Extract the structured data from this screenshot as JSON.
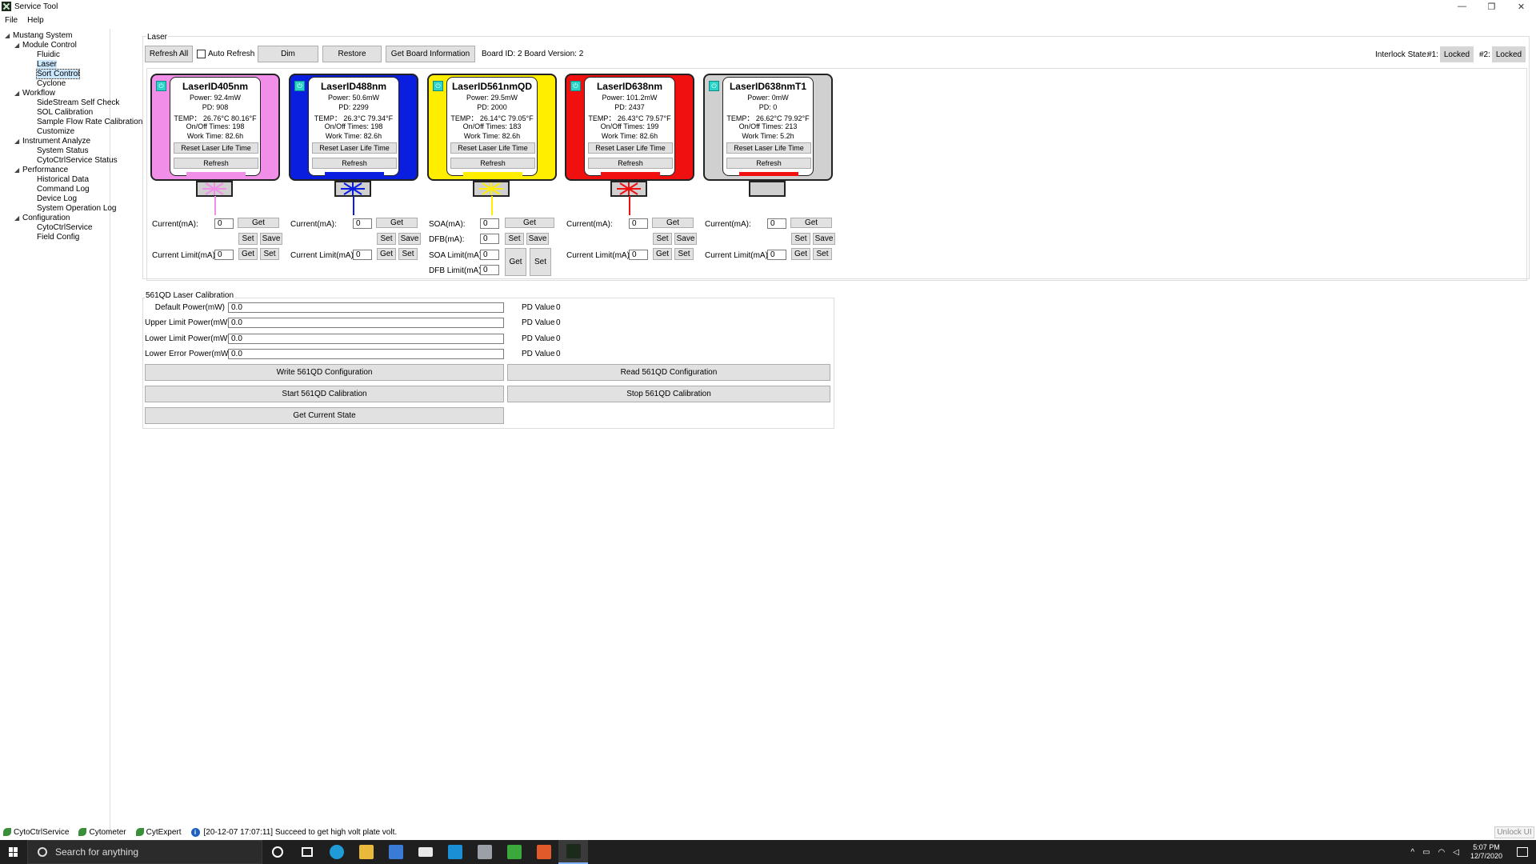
{
  "window": {
    "title": "Service Tool",
    "min": "—",
    "restore": "❐",
    "close": "✕"
  },
  "menu": [
    "File",
    "Help"
  ],
  "tree": {
    "root": "Mustang System",
    "groups": [
      {
        "label": "Module Control",
        "items": [
          "Fluidic",
          "Laser",
          "Sort Control",
          "Cyclone"
        ]
      },
      {
        "label": "Workflow",
        "items": [
          "SideStream Self Check",
          "SOL Calibration",
          "Sample Flow Rate Calibration",
          "Customize"
        ]
      },
      {
        "label": "Instrument Analyze",
        "items": [
          "System Status",
          "CytoCtrlService Status"
        ]
      },
      {
        "label": "Performance",
        "items": [
          "Historical Data",
          "Command Log",
          "Device Log",
          "System Operation Log"
        ]
      },
      {
        "label": "Configuration",
        "items": [
          "CytoCtrlService",
          "Field Config"
        ]
      }
    ]
  },
  "laser_group": {
    "title": "Laser",
    "refresh_all": "Refresh All",
    "auto_refresh": "Auto Refresh",
    "dim": "Dim",
    "restore": "Restore",
    "get_board_info": "Get Board Information",
    "board_info": "Board ID: 2 Board Version: 2",
    "interlock_label": "Interlock State:",
    "interlock1_label": "#1:",
    "interlock1_value": "Locked",
    "interlock2_label": "#2:",
    "interlock2_value": "Locked"
  },
  "lasers": [
    {
      "name": "LaserID405nm",
      "power": "Power: 92.4mW",
      "pd": "PD: 908",
      "temp": "TEMP： 26.76°C 80.16°F",
      "onoff": "On/Off Times: 198",
      "work": "Work Time: 82.6h",
      "color": "#f08ee8",
      "bar": "#f08ee8",
      "beam": "#f08ee8"
    },
    {
      "name": "LaserID488nm",
      "power": "Power: 50.6mW",
      "pd": "PD: 2299",
      "temp": "TEMP： 26.3°C 79.34°F",
      "onoff": "On/Off Times: 198",
      "work": "Work Time: 82.6h",
      "color": "#0a1ee0",
      "bar": "#0a1ee0",
      "beam": "#0a1ee0"
    },
    {
      "name": "LaserID561nmQD",
      "power": "Power: 29.5mW",
      "pd": "PD: 2000",
      "temp": "TEMP： 26.14°C 79.05°F",
      "onoff": "On/Off Times: 183",
      "work": "Work Time: 82.6h",
      "color": "#ffee00",
      "bar": "#ffee00",
      "beam": "#ffee00"
    },
    {
      "name": "LaserID638nm",
      "power": "Power: 101.2mW",
      "pd": "PD: 2437",
      "temp": "TEMP： 26.43°C 79.57°F",
      "onoff": "On/Off Times: 199",
      "work": "Work Time: 82.6h",
      "color": "#f01010",
      "bar": "#f01010",
      "beam": "#f01010"
    },
    {
      "name": "LaserID638nmT1",
      "power": "Power: 0mW",
      "pd": "PD: 0",
      "temp": "TEMP： 26.62°C 79.92°F",
      "onoff": "On/Off Times: 213",
      "work": "Work Time: 5.2h",
      "color": "#d0d0d0",
      "bar": "#f01010",
      "beam": "none"
    }
  ],
  "card_buttons": {
    "reset": "Reset Laser Life Time",
    "refresh": "Refresh"
  },
  "controls": {
    "current_label": "Current(mA):",
    "current_limit_label": "Current Limit(mA):",
    "soa_label": "SOA(mA):",
    "dfb_label": "DFB(mA):",
    "soa_limit_label": "SOA Limit(mA):",
    "dfb_limit_label": "DFB Limit(mA):",
    "value": "0",
    "get": "Get",
    "set": "Set",
    "save": "Save"
  },
  "calibration": {
    "title": "561QD Laser Calibration",
    "rows": [
      {
        "label": "Default Power(mW)",
        "value": "0.0",
        "pd_label": "PD Value",
        "pd_value": "0"
      },
      {
        "label": "Upper Limit Power(mW)",
        "value": "0.0",
        "pd_label": "PD Value",
        "pd_value": "0"
      },
      {
        "label": "Lower Limit Power(mW)",
        "value": "0.0",
        "pd_label": "PD Value",
        "pd_value": "0"
      },
      {
        "label": "Lower Error Power(mW)",
        "value": "0.0",
        "pd_label": "PD Value",
        "pd_value": "0"
      }
    ],
    "write": "Write 561QD Configuration",
    "read": "Read 561QD Configuration",
    "start": "Start 561QD Calibration",
    "stop": "Stop 561QD Calibration",
    "get_state": "Get Current State"
  },
  "status": {
    "items": [
      "CytoCtrlService",
      "Cytometer",
      "CytExpert"
    ],
    "message": "[20-12-07 17:07:11] Succeed to get high volt plate volt.",
    "unlock": "Unlock UI"
  },
  "taskbar": {
    "search_placeholder": "Search for anything",
    "time": "5:07 PM",
    "date": "12/7/2020"
  }
}
